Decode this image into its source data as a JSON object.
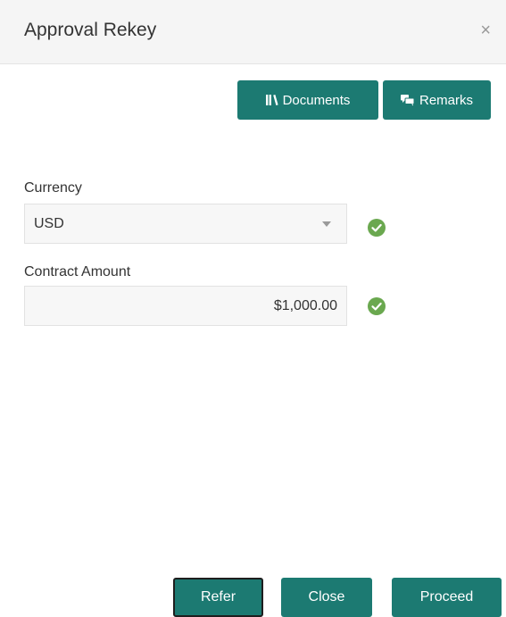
{
  "dialog": {
    "title": "Approval Rekey",
    "close_symbol": "×"
  },
  "toolbar": {
    "documents_label": "Documents",
    "documents_icon": "library-icon",
    "remarks_label": "Remarks",
    "remarks_icon": "chat-icon"
  },
  "form": {
    "currency": {
      "label": "Currency",
      "value": "USD",
      "valid": true
    },
    "contract_amount": {
      "label": "Contract Amount",
      "value": "$1,000.00",
      "valid": true
    }
  },
  "footer": {
    "refer_label": "Refer",
    "close_label": "Close",
    "proceed_label": "Proceed"
  },
  "colors": {
    "primary": "#1c7a72",
    "success": "#6aa84f",
    "header_bg": "#f5f5f5",
    "field_bg": "#f7f7f7"
  }
}
